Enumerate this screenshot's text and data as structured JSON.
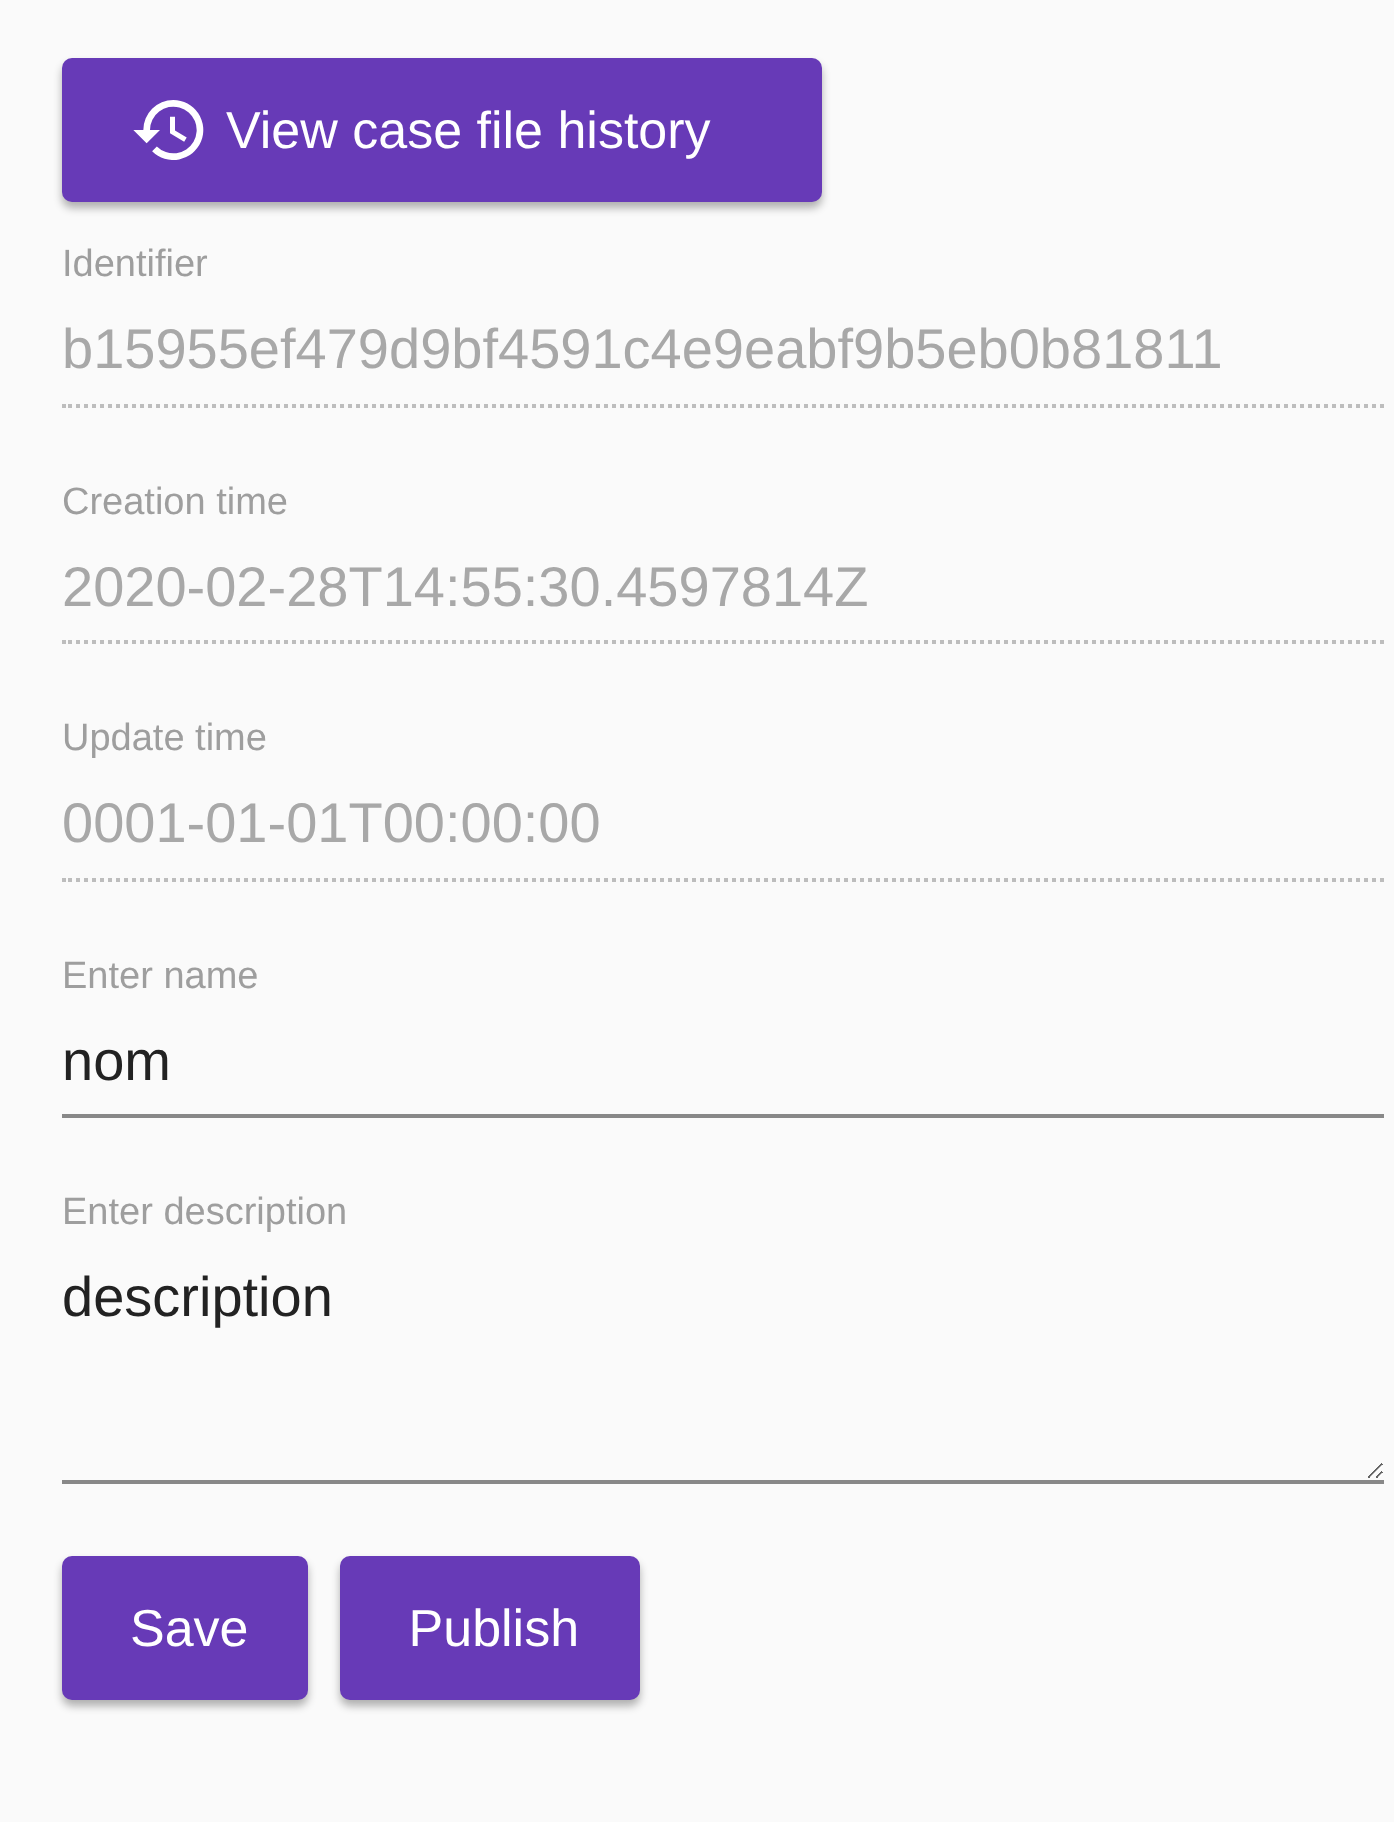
{
  "history_button": {
    "label": "View case file history"
  },
  "fields": [
    {
      "kind": "text",
      "label": "Identifier",
      "value": "b15955ef479d9bf4591c4e9eabf9b5eb0b81811",
      "disabled": true
    },
    {
      "kind": "text",
      "label": "Creation time",
      "value": "2020-02-28T14:55:30.4597814Z",
      "disabled": true
    },
    {
      "kind": "text",
      "label": "Update time",
      "value": "0001-01-01T00:00:00",
      "disabled": true
    },
    {
      "kind": "text",
      "label": "Enter name",
      "value": "nom",
      "disabled": false
    },
    {
      "kind": "textarea",
      "label": "Enter description",
      "value": "description",
      "disabled": false
    }
  ],
  "buttons": [
    {
      "label": "Save"
    },
    {
      "label": "Publish"
    }
  ]
}
